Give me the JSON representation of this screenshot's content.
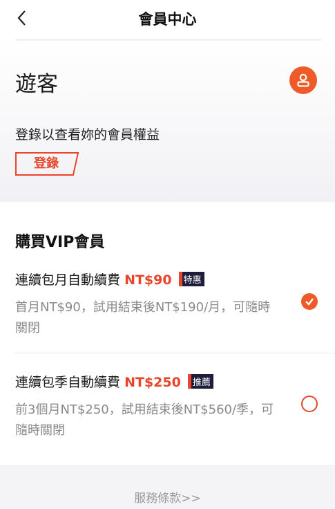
{
  "header": {
    "title": "會員中心",
    "back_icon": "chevron-left-icon"
  },
  "profile": {
    "name": "遊客",
    "avatar_icon": "user-icon",
    "description": "登錄以查看妳的會員權益",
    "login_label": "登錄"
  },
  "vip": {
    "section_title": "購買VIP會員",
    "plans": [
      {
        "name": "連續包月自動續費",
        "price": "NT$90",
        "tag": "特惠",
        "desc": "首月NT$90，試用結束後NT$190/月，可隨時關閉",
        "selected": true
      },
      {
        "name": "連續包季自動續費",
        "price": "NT$250",
        "tag": "推薦",
        "desc": "前3個月NT$250，試用結束後NT$560/季，可隨時關閉",
        "selected": false
      }
    ]
  },
  "footer": {
    "terms_label": "服務條款>>"
  },
  "colors": {
    "accent": "#e8452a",
    "tag_bg": "#1e1e3c",
    "muted_text": "#8a8a8a"
  }
}
